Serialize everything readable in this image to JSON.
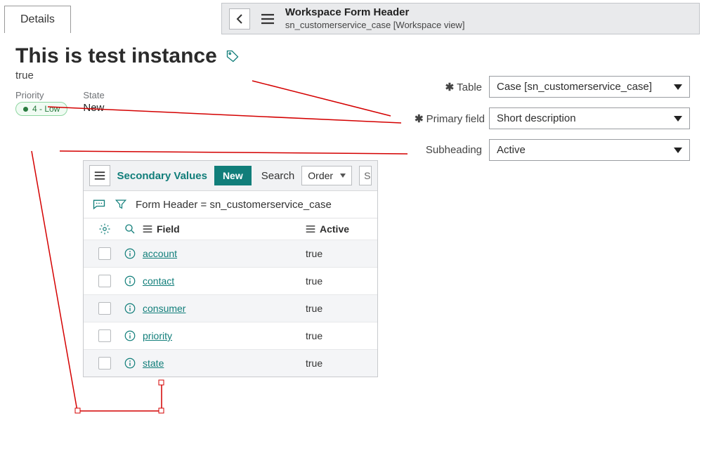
{
  "tabs": {
    "details": "Details"
  },
  "header": {
    "title": "Workspace Form Header",
    "subtitle": "sn_customerservice_case [Workspace view]"
  },
  "page": {
    "title": "This is test instance",
    "subtrue": "true"
  },
  "meta": {
    "priority_label": "Priority",
    "priority_value": "4 - Low",
    "state_label": "State",
    "state_value": "New"
  },
  "config": {
    "table_label": "Table",
    "table_value": "Case [sn_customerservice_case]",
    "primary_label": "Primary field",
    "primary_value": "Short description",
    "sub_label": "Subheading",
    "sub_value": "Active"
  },
  "sv": {
    "title": "Secondary Values",
    "new": "New",
    "search": "Search",
    "order_select": "Order",
    "search_box": "S",
    "filter_text": "Form Header = sn_customerservice_case",
    "col_field": "Field",
    "col_active": "Active",
    "rows": [
      {
        "field": "account",
        "active": "true"
      },
      {
        "field": "contact",
        "active": "true"
      },
      {
        "field": "consumer",
        "active": "true"
      },
      {
        "field": "priority",
        "active": "true"
      },
      {
        "field": "state",
        "active": "true"
      }
    ]
  }
}
